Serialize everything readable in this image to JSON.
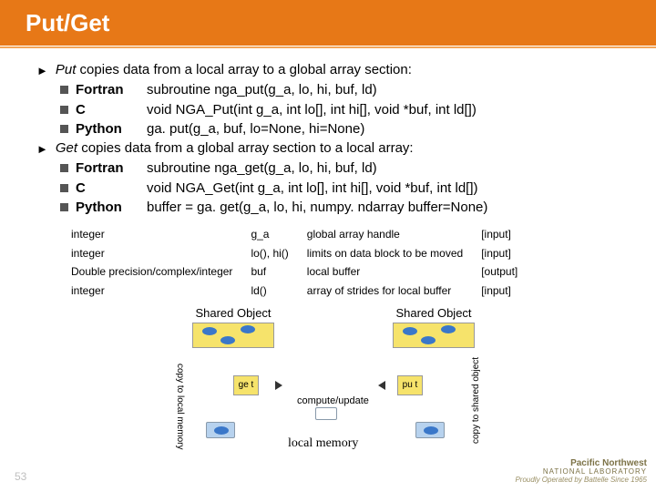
{
  "title": "Put/Get",
  "bullets": {
    "put_intro_prefix": "Put",
    "put_intro_rest": " copies data from a local array to a global array section:",
    "get_intro_prefix": "Get",
    "get_intro_rest": " copies data from a global array section to a local array:",
    "langs": {
      "fortran": "Fortran",
      "c": "C",
      "python": "Python"
    },
    "put": {
      "fortran": "subroutine nga_put(g_a, lo, hi, buf, ld)",
      "c": "void NGA_Put(int g_a, int lo[], int hi[], void *buf, int ld[])",
      "python": "ga. put(g_a, buf, lo=None, hi=None)"
    },
    "get": {
      "fortran": "subroutine nga_get(g_a, lo, hi, buf, ld)",
      "c": "void NGA_Get(int g_a, int lo[], int hi[], void *buf, int ld[])",
      "python": "buffer = ga. get(g_a, lo, hi, numpy. ndarray buffer=None)"
    }
  },
  "params": [
    {
      "type": "integer",
      "name": "g_a",
      "desc": "global array handle",
      "dir": "[input]"
    },
    {
      "type": "integer",
      "name": "lo(), hi()",
      "desc": "limits on data block to be moved",
      "dir": "[input]"
    },
    {
      "type": "Double precision/complex/integer",
      "name": "buf",
      "desc": "local buffer",
      "dir": "[output]"
    },
    {
      "type": "integer",
      "name": "ld()",
      "desc": "array of strides for local buffer",
      "dir": "[input]"
    }
  ],
  "diagram": {
    "shared_label": "Shared Object",
    "get": "ge t",
    "put": "pu t",
    "copy_local": "copy to local memory",
    "copy_shared": "copy to shared object",
    "compute": "compute/update",
    "local_mem": "local memory"
  },
  "footer": {
    "lab": "Pacific Northwest",
    "sub": "NATIONAL LABORATORY",
    "op": "Proudly Operated by Battelle Since 1965"
  },
  "page": "53"
}
